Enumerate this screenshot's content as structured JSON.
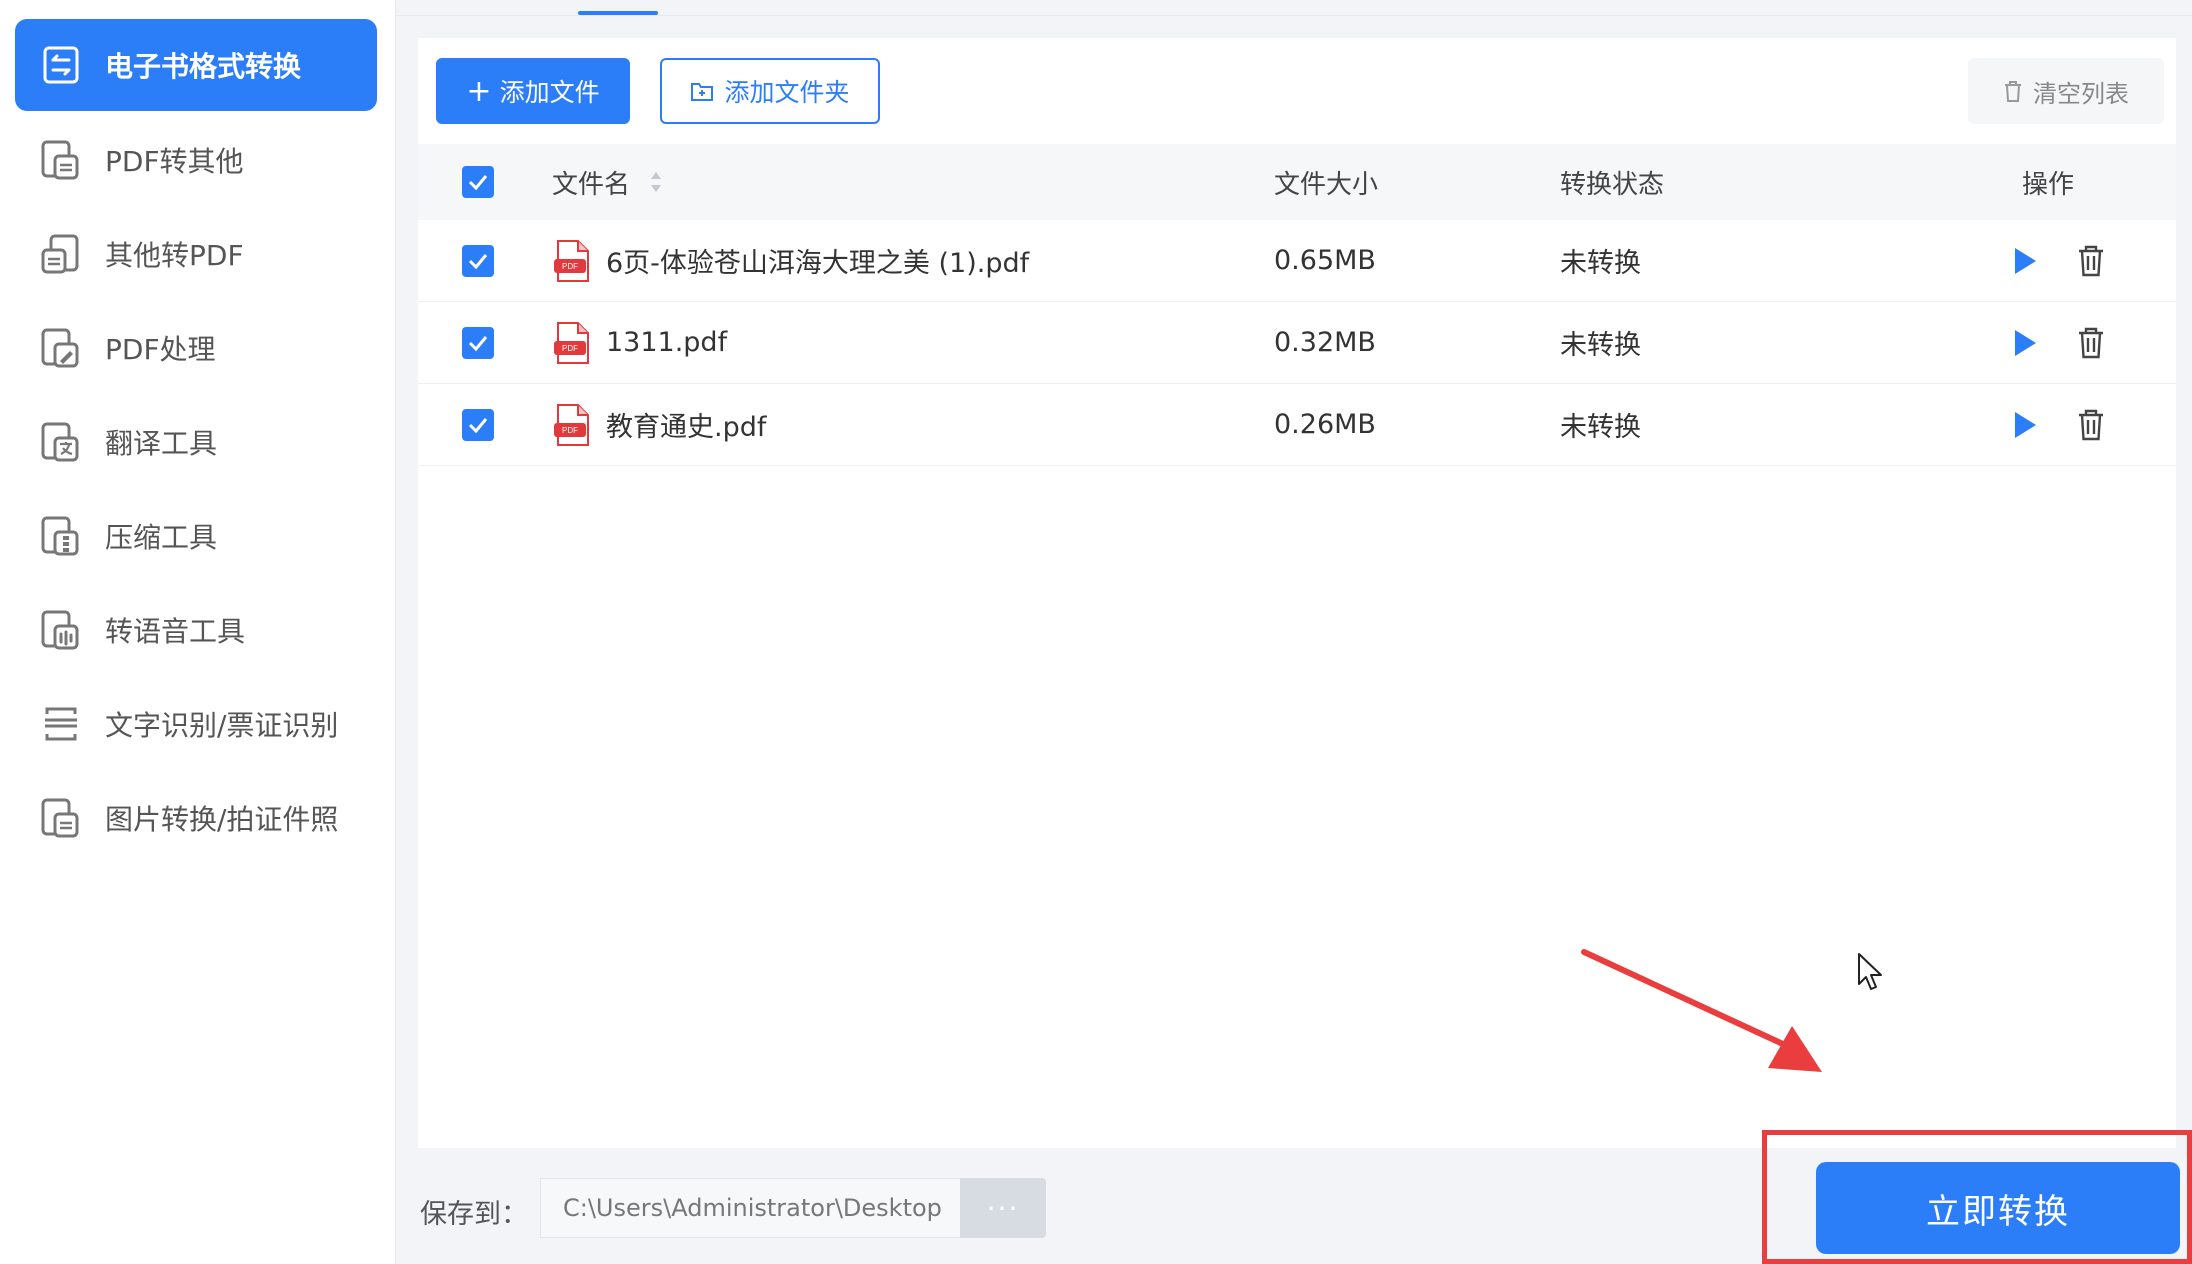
{
  "sidebar": {
    "items": [
      {
        "label": "电子书格式转换",
        "icon": "ebook-convert-icon",
        "active": true
      },
      {
        "label": "PDF转其他",
        "icon": "pdf-to-other-icon"
      },
      {
        "label": "其他转PDF",
        "icon": "other-to-pdf-icon"
      },
      {
        "label": "PDF处理",
        "icon": "pdf-edit-icon"
      },
      {
        "label": "翻译工具",
        "icon": "translate-icon"
      },
      {
        "label": "压缩工具",
        "icon": "compress-icon"
      },
      {
        "label": "转语音工具",
        "icon": "audio-icon"
      },
      {
        "label": "文字识别/票证识别",
        "icon": "ocr-icon"
      },
      {
        "label": "图片转换/拍证件照",
        "icon": "image-convert-icon"
      }
    ]
  },
  "toolbar": {
    "add_file": "添加文件",
    "add_folder": "添加文件夹",
    "clear_list": "清空列表"
  },
  "table": {
    "headers": {
      "name": "文件名",
      "size": "文件大小",
      "status": "转换状态",
      "ops": "操作"
    },
    "rows": [
      {
        "name": "6页-体验苍山洱海大理之美 (1).pdf",
        "size": "0.65MB",
        "status": "未转换"
      },
      {
        "name": "1311.pdf",
        "size": "0.32MB",
        "status": "未转换"
      },
      {
        "name": "教育通史.pdf",
        "size": "0.26MB",
        "status": "未转换"
      }
    ]
  },
  "save": {
    "label": "保存到：",
    "path": "C:\\Users\\Administrator\\Desktop",
    "more": "···"
  },
  "convert_button": "立即转换",
  "colors": {
    "accent": "#2c7ef8",
    "highlight": "#ea3d3e"
  }
}
